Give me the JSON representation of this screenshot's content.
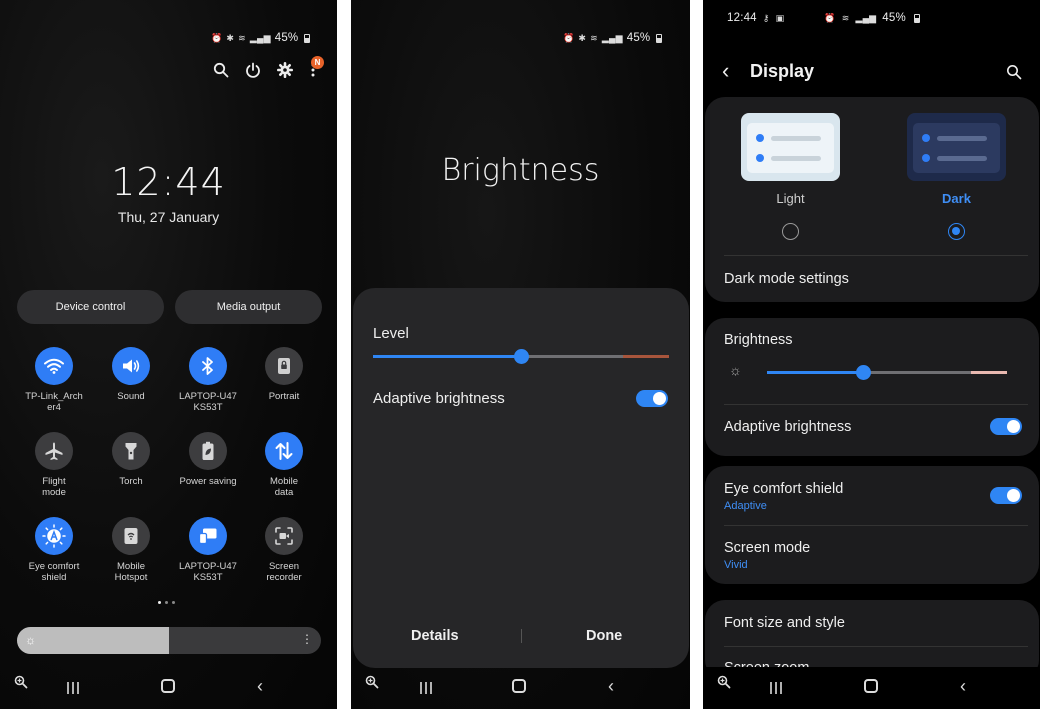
{
  "colors": {
    "accent": "#2f7df6",
    "panel": "#262628",
    "card": "#1c1c1e"
  },
  "status_bar": {
    "battery": "45%",
    "time": "12:44"
  },
  "lockscreen": {
    "clock": "12:44",
    "date": "Thu, 27 January",
    "notification_badge": "N",
    "buttons": {
      "device_control": "Device control",
      "media_output": "Media output"
    },
    "tiles": [
      {
        "label": "TP-Link_Arch\ner4",
        "icon": "wifi-icon",
        "on": true
      },
      {
        "label": "Sound",
        "icon": "speaker-icon",
        "on": true
      },
      {
        "label": "LAPTOP-U47\nKS53T",
        "icon": "bluetooth-icon",
        "on": true
      },
      {
        "label": "Portrait",
        "icon": "lock-rotation-icon",
        "on": false
      },
      {
        "label": "Flight\nmode",
        "icon": "airplane-icon",
        "on": false
      },
      {
        "label": "Torch",
        "icon": "torch-icon",
        "on": false
      },
      {
        "label": "Power saving",
        "icon": "battery-leaf-icon",
        "on": false
      },
      {
        "label": "Mobile\ndata",
        "icon": "data-arrows-icon",
        "on": true
      },
      {
        "label": "Eye comfort\nshield",
        "icon": "eye-comfort-icon",
        "on": true
      },
      {
        "label": "Mobile\nHotspot",
        "icon": "hotspot-icon",
        "on": false
      },
      {
        "label": "LAPTOP-U47\nKS53T",
        "icon": "smart-view-icon",
        "on": true
      },
      {
        "label": "Screen\nrecorder",
        "icon": "screen-recorder-icon",
        "on": false
      }
    ],
    "brightness_level": 0.5
  },
  "brightness_dialog": {
    "title": "Brightness",
    "level_label": "Level",
    "level": 0.5,
    "adaptive_label": "Adaptive brightness",
    "adaptive_on": true,
    "details_button": "Details",
    "done_button": "Done"
  },
  "display_settings": {
    "title": "Display",
    "light_label": "Light",
    "dark_label": "Dark",
    "selected_mode": "Dark",
    "dark_mode_settings": "Dark mode settings",
    "brightness_label": "Brightness",
    "brightness_level": 0.4,
    "adaptive_label": "Adaptive brightness",
    "adaptive_on": true,
    "eye_comfort_label": "Eye comfort shield",
    "eye_comfort_sub": "Adaptive",
    "eye_comfort_on": true,
    "screen_mode_label": "Screen mode",
    "screen_mode_sub": "Vivid",
    "font_size_label": "Font size and style",
    "screen_zoom_label": "Screen zoom"
  }
}
